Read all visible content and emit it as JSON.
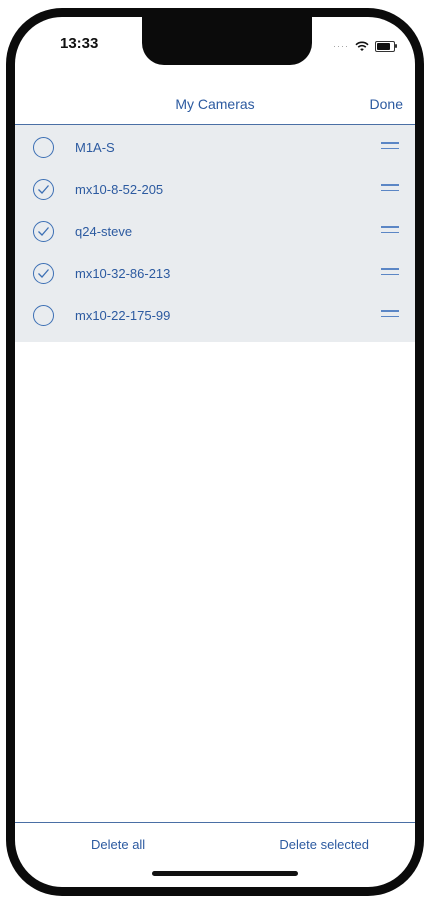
{
  "status_bar": {
    "time": "13:33",
    "signal_icon": "signal-dots-icon",
    "wifi_icon": "wifi-icon",
    "battery_icon": "battery-icon"
  },
  "nav": {
    "title": "My Cameras",
    "done_label": "Done"
  },
  "cameras": [
    {
      "name": "M1A-S",
      "selected": false
    },
    {
      "name": "mx10-8-52-205",
      "selected": true
    },
    {
      "name": "q24-steve",
      "selected": true
    },
    {
      "name": "mx10-32-86-213",
      "selected": true
    },
    {
      "name": "mx10-22-175-99",
      "selected": false
    }
  ],
  "footer": {
    "delete_all_label": "Delete all",
    "delete_selected_label": "Delete selected"
  },
  "colors": {
    "accent": "#2c5aa0",
    "list_background": "#e9ecef"
  }
}
